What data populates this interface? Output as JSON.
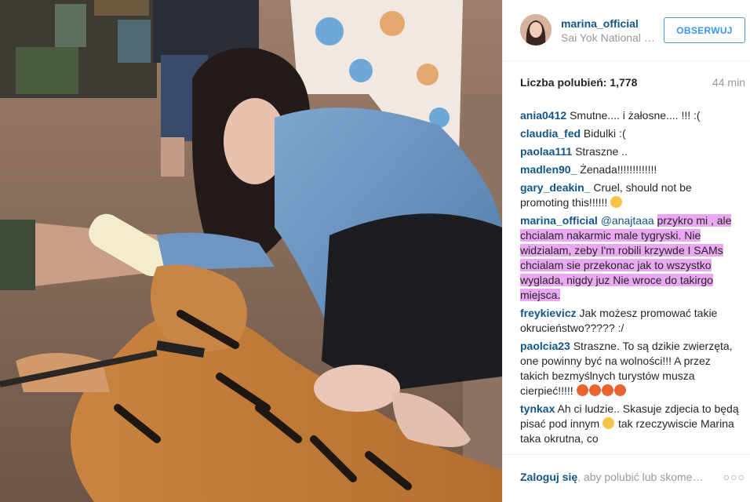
{
  "post": {
    "username": "marina_official",
    "location": "Sai Yok National Park",
    "follow_label": "OBSERWUJ",
    "likes_text": "Liczba polubień: 1,778",
    "time_ago": "44 min"
  },
  "comments": [
    {
      "user": "ania0412",
      "text": "Smutne.... i żałosne.... !!! :("
    },
    {
      "user": "claudia_fed",
      "text": "Bidulki :("
    },
    {
      "user": "paolaa111",
      "text": "Straszne .."
    },
    {
      "user": "madlen90_",
      "text": "Żenada!!!!!!!!!!!!!"
    },
    {
      "user": "gary_deakin_",
      "text": "Cruel, should not be promoting this!!!!!!",
      "emoji": "unamused-emoji"
    },
    {
      "user": "marina_official",
      "mention": "@anajtaaa",
      "text": "przykro mi , ale chcialam nakarmic male tygryski. Nie widzialam, zeby I'm robili krzywde I SAMs chcialam sie przekonac jak to wszystko wyglada, nigdy juz Nie wroce do takirgo miejsca.",
      "highlighted": true
    },
    {
      "user": "freykievicz",
      "text": "Jak możesz promować takie okrucieństwo????? :/"
    },
    {
      "user": "paolcia23",
      "text": "Straszne. To są dzikie zwierzęta, one powinny być na wolności!!! A przez takich bezmyślnych turystów musza cierpieć!!!!!",
      "emoji_count": 4
    },
    {
      "user": "tynkax",
      "text": "Ah ci ludzie.. Skasuje zdjecia to będą pisać pod innym",
      "text2": "tak rzeczywiscie Marina taka okrutna, co"
    }
  ],
  "footer": {
    "login_link": "Zaloguj się",
    "login_rest": ", aby polubić lub skomentować.",
    "more_label": "○○○"
  },
  "colors": {
    "username": "#125688",
    "follow_border": "#4f97d8",
    "follow_text": "#3897f0",
    "highlight": "#eaa7f2",
    "muted": "#999999"
  }
}
